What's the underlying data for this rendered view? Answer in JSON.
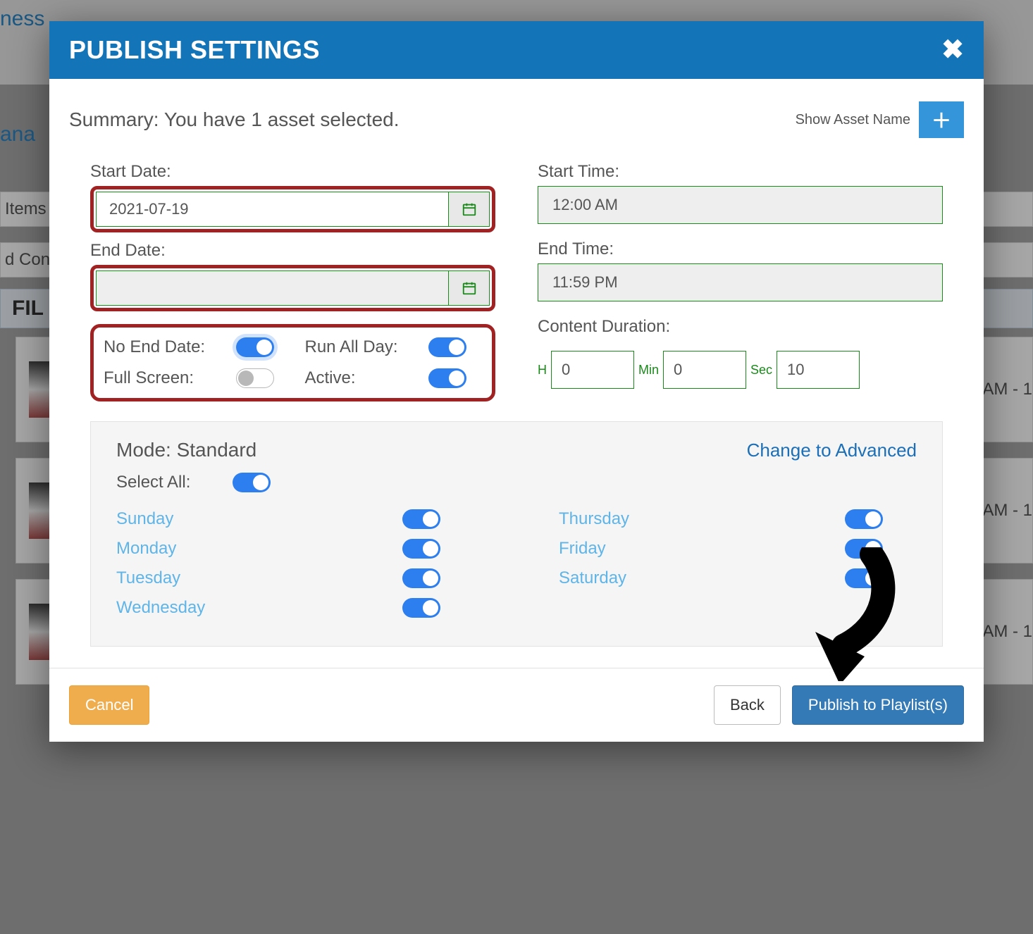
{
  "bg": {
    "topLink": "ness",
    "link2": "ana",
    "items": "Items",
    "content": "d Conte",
    "fil": "FIL",
    "timeText": "AM - 1"
  },
  "modal": {
    "title": "PUBLISH SETTINGS",
    "summary": "Summary: You have 1 asset selected.",
    "showAssetName": "Show Asset Name",
    "startDateLabel": "Start Date:",
    "startDateValue": "2021-07-19",
    "endDateLabel": "End Date:",
    "endDateValue": "",
    "startTimeLabel": "Start Time:",
    "startTimeValue": "12:00 AM",
    "endTimeLabel": "End Time:",
    "endTimeValue": "11:59 PM",
    "toggles": {
      "noEndDate": {
        "label": "No End Date:",
        "on": true
      },
      "runAllDay": {
        "label": "Run All Day:",
        "on": true
      },
      "fullScreen": {
        "label": "Full Screen:",
        "on": false
      },
      "active": {
        "label": "Active:",
        "on": true
      }
    },
    "contentDurationLabel": "Content Duration:",
    "duration": {
      "hLabel": "H",
      "h": "0",
      "minLabel": "Min",
      "min": "0",
      "secLabel": "Sec",
      "sec": "10"
    },
    "mode": {
      "title": "Mode: Standard",
      "changeLink": "Change to Advanced",
      "selectAllLabel": "Select All:",
      "selectAllOn": true,
      "days": {
        "sunday": "Sunday",
        "monday": "Monday",
        "tuesday": "Tuesday",
        "wednesday": "Wednesday",
        "thursday": "Thursday",
        "friday": "Friday",
        "saturday": "Saturday"
      }
    },
    "footer": {
      "cancel": "Cancel",
      "back": "Back",
      "publish": "Publish to Playlist(s)"
    }
  }
}
